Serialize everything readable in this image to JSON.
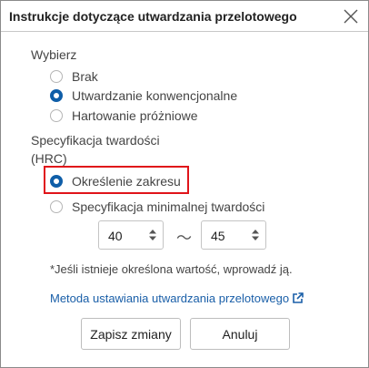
{
  "dialog": {
    "title": "Instrukcje dotyczące utwardzania przelotowego",
    "close_icon": "close-icon"
  },
  "select_section": {
    "label": "Wybierz",
    "options": [
      {
        "label": "Brak",
        "checked": false
      },
      {
        "label": "Utwardzanie konwencjonalne",
        "checked": true
      },
      {
        "label": "Hartowanie próżniowe",
        "checked": false
      }
    ]
  },
  "hardness_section": {
    "label_line1": "Specyfikacja twardości",
    "label_line2": "(HRC)",
    "options": [
      {
        "label": "Określenie zakresu",
        "checked": true
      },
      {
        "label": "Specyfikacja minimalnej twardości",
        "checked": false
      }
    ],
    "range": {
      "min": "40",
      "separator": "〜",
      "max": "45"
    }
  },
  "note": "*Jeśli istnieje określona wartość, wprowadź ją.",
  "link": {
    "label": "Metoda ustawiania utwardzania przelotowego",
    "icon": "external-link-icon"
  },
  "buttons": {
    "save": "Zapisz zmiany",
    "cancel": "Anuluj"
  },
  "colors": {
    "accent": "#0f5ea8",
    "link": "#1a5fa8",
    "highlight": "#e0141a"
  }
}
